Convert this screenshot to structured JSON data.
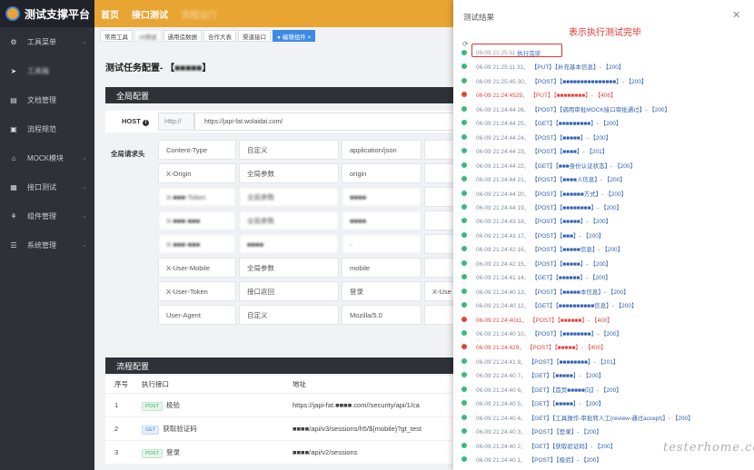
{
  "app": {
    "title": "测试支撑平台"
  },
  "topnav": [
    "首页",
    "接口测试",
    "流程运行"
  ],
  "sidebar": {
    "items": [
      {
        "icon": "settings-icon",
        "glyph": "⚙",
        "label": "工具菜单",
        "arrow": true
      },
      {
        "icon": "send-icon",
        "glyph": "➤",
        "label": "工具箱",
        "arrow": false,
        "blur": true
      },
      {
        "icon": "doc-icon",
        "glyph": "▤",
        "label": "文档管理",
        "arrow": false
      },
      {
        "icon": "flow-icon",
        "glyph": "▣",
        "label": "流程规范",
        "arrow": false
      },
      {
        "icon": "mock-icon",
        "glyph": "⌂",
        "label": "MOCK模块",
        "arrow": true
      },
      {
        "icon": "api-icon",
        "glyph": "▦",
        "label": "接口测试",
        "arrow": true
      },
      {
        "icon": "component-icon",
        "glyph": "⚘",
        "label": "组件管理",
        "arrow": true
      },
      {
        "icon": "system-icon",
        "glyph": "☰",
        "label": "系统管理",
        "arrow": true
      }
    ]
  },
  "tabs": [
    {
      "label": "常用工具",
      "active": false
    },
    {
      "label": "UI测试",
      "active": false,
      "blur": true
    },
    {
      "label": "通用造数据",
      "active": false
    },
    {
      "label": "合作大表",
      "active": false
    },
    {
      "label": "渠道接口",
      "active": false
    },
    {
      "label": "● 编辑组件 ×",
      "active": true
    }
  ],
  "page": {
    "title": "测试任务配置- 【",
    "title_blur": "■■■■■",
    "title_end": "】"
  },
  "global_config": {
    "section_title": "全局配置",
    "host_label": "HOST",
    "host_prefix": "Http://",
    "host_value": "https://japi-fat.wolaidai.com/",
    "headers_label": "全局请求头",
    "headers": [
      {
        "key": "Content-Type",
        "type": "自定义",
        "value": "application/json",
        "extra": ""
      },
      {
        "key": "X-Origin",
        "type": "全局参数",
        "value": "origin",
        "extra": ""
      },
      {
        "key": "X-■■■-Token",
        "type": "全局参数",
        "value": "■■■■",
        "extra": "",
        "blur": true
      },
      {
        "key": "X-■■■-■■■",
        "type": "全局参数",
        "value": "■■■■",
        "extra": "",
        "blur": true
      },
      {
        "key": "X-■■■-■■■",
        "type": "■■■■",
        "value": "-",
        "extra": "",
        "blur": true
      },
      {
        "key": "X-User-Mobile",
        "type": "全局参数",
        "value": "mobile",
        "extra": ""
      },
      {
        "key": "X-User-Token",
        "type": "接口返回",
        "value": "登录",
        "extra": "X-Use"
      },
      {
        "key": "User-Agent",
        "type": "自定义",
        "value": "Mozilla/5.0",
        "extra": ""
      }
    ]
  },
  "flow_config": {
    "section_title": "流程配置",
    "columns": [
      "序号",
      "执行接口",
      "地址"
    ],
    "rows": [
      {
        "no": "1",
        "method": "POST",
        "name": "极验",
        "url": "https://japi-fat.■■■■.com//security/api/1/ca"
      },
      {
        "no": "2",
        "method": "GET",
        "name": "获取验证码",
        "url": "■■■■/api/v3/sessions/h5/${mobile}?gt_test"
      },
      {
        "no": "3",
        "method": "POST",
        "name": "登录",
        "url": "■■■■/api/v2/sessions"
      }
    ]
  },
  "drawer": {
    "title": "测试结果",
    "annotation": "表示执行测试完毕",
    "logs": [
      {
        "status": "ok",
        "time": "06-09 21:25:11",
        "text": "执行完毕",
        "done": true
      },
      {
        "status": "ok",
        "time": "06-09 21:25:11 31、",
        "text": "【PUT】【补充基本信息】- 【200】"
      },
      {
        "status": "ok",
        "time": "06-09 21:25:45 30、",
        "text": "【POST】【■■■■■■■■■■■■■■■】- 【200】"
      },
      {
        "status": "err",
        "time": "06-09 21:24:4529、",
        "text": "【PUT】【■■■■■■■■】- 【406】"
      },
      {
        "status": "ok",
        "time": "06-09 21:24:44 26、",
        "text": "【POST】【调用审批MOCK接口审批通过】- 【200】"
      },
      {
        "status": "ok",
        "time": "06-09 21:24:44 25、",
        "text": "【GET】【■■■■■■■■■】- 【200】"
      },
      {
        "status": "ok",
        "time": "06-09 21:24:44 24、",
        "text": "【POST】【■■■■■】- 【200】"
      },
      {
        "status": "ok",
        "time": "06-09 21:24:44 23、",
        "text": "【POST】【■■■■】- 【201】"
      },
      {
        "status": "ok",
        "time": "06-09 21:24:44 22、",
        "text": "【GET】【■■■身份认证状态】- 【200】"
      },
      {
        "status": "ok",
        "time": "06-09 21:24:44 21、",
        "text": "【POST】【■■■■人信息】- 【200】"
      },
      {
        "status": "ok",
        "time": "06-09 21:24:44 20、",
        "text": "【POST】【■■■■■■方式】- 【200】"
      },
      {
        "status": "ok",
        "time": "06-09 21:24:44 19、",
        "text": "【POST】【■■■■■■■■】- 【200】"
      },
      {
        "status": "ok",
        "time": "06-09 21:24:43 18、",
        "text": "【POST】【■■■■■】- 【200】"
      },
      {
        "status": "ok",
        "time": "06-09 21:24:43 17、",
        "text": "【POST】【■■■】- 【200】"
      },
      {
        "status": "ok",
        "time": "06-09 21:24:42 16、",
        "text": "【POST】【■■■■■信息】- 【200】"
      },
      {
        "status": "ok",
        "time": "06-09 21:24:42 15、",
        "text": "【POST】【■■■■■】- 【200】"
      },
      {
        "status": "ok",
        "time": "06-09 21:24:41 14、",
        "text": "【GET】【■■■■■■】- 【200】"
      },
      {
        "status": "ok",
        "time": "06-09 21:24:40 13、",
        "text": "【POST】【■■■■■本信息】- 【200】"
      },
      {
        "status": "ok",
        "time": "06-09 21:24:40 12、",
        "text": "【GET】【■■■■■■■■■■信息】- 【200】"
      },
      {
        "status": "err",
        "time": "06-09 21:24:4011、",
        "text": "【POST】【■■■■■■】- 【400】"
      },
      {
        "status": "ok",
        "time": "06-09 21:24:40 10、",
        "text": "【POST】【■■■■■■■■】- 【200】"
      },
      {
        "status": "err",
        "time": "06-09 21:24:429、",
        "text": "【POST】【■■■■■】- 【400】"
      },
      {
        "status": "ok",
        "time": "06-09 21:24:41 8、",
        "text": "【POST】【■■■■■■■■】- 【201】"
      },
      {
        "status": "ok",
        "time": "06-09 21:24:40 7、",
        "text": "【GET】【■■■■■】- 【200】"
      },
      {
        "status": "ok",
        "time": "06-09 21:24:40 6、",
        "text": "【GET】【首页■■■■■向】- 【200】"
      },
      {
        "status": "ok",
        "time": "06-09 21:24:40 5、",
        "text": "【GET】【■■■■■】- 【200】"
      },
      {
        "status": "ok",
        "time": "06-09 21:24:40 4、",
        "text": "【GET】【工具操作-审批转人工(review-通过accept)】- 【200】"
      },
      {
        "status": "ok",
        "time": "06-09 21:24:40 3、",
        "text": "【POST】【登录】- 【200】"
      },
      {
        "status": "ok",
        "time": "06-09 21:24:40 2、",
        "text": "【GET】【获取验证码】- 【200】"
      },
      {
        "status": "ok",
        "time": "06-09 21:24:40 1、",
        "text": "【POST】【极验】- 【200】"
      }
    ]
  },
  "watermark": "testerhome.com"
}
